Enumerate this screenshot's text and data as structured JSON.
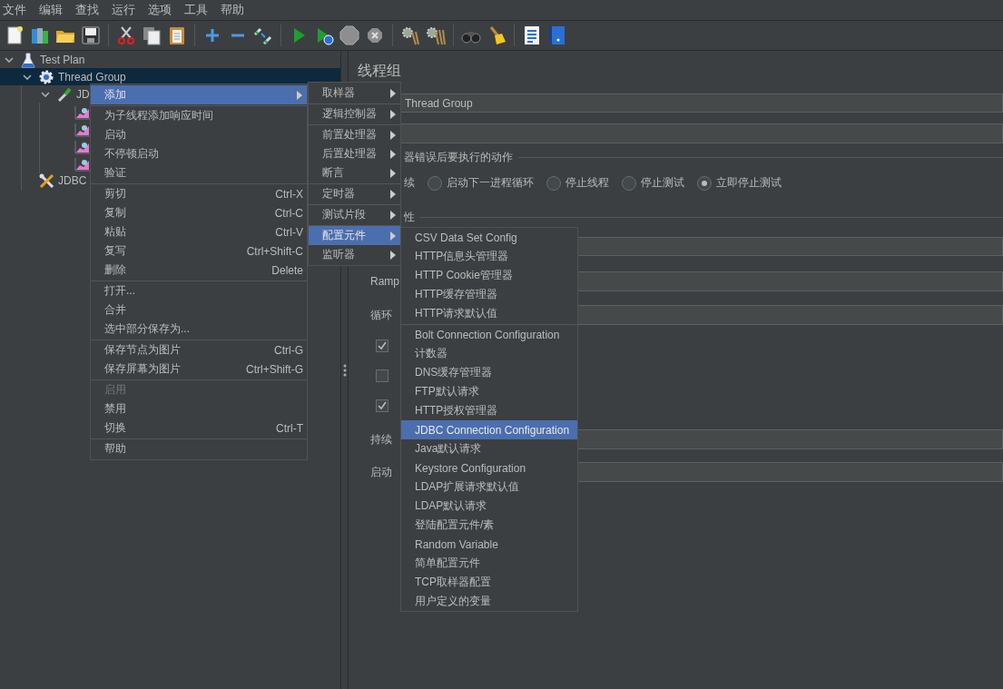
{
  "menu_bar": [
    "文件",
    "编辑",
    "查找",
    "运行",
    "选项",
    "工具",
    "帮助"
  ],
  "tree": [
    {
      "label": "Test Plan",
      "kind": "test-plan",
      "expanded": true,
      "selected": false,
      "children": [
        {
          "label": "Thread Group",
          "kind": "thread-group",
          "expanded": true,
          "selected": true,
          "children": [
            {
              "label": "JD",
              "kind": "sampler",
              "expanded": true,
              "selected": false,
              "children": [
                {
                  "kind": "listener",
                  "selected": false
                },
                {
                  "kind": "listener",
                  "selected": false
                },
                {
                  "kind": "listener",
                  "selected": false
                },
                {
                  "kind": "listener",
                  "selected": false
                }
              ]
            }
          ]
        },
        {
          "label": "JDBC",
          "kind": "config",
          "selected": false
        }
      ]
    }
  ],
  "panel": {
    "title": "线程组",
    "name_field": {
      "value": "Thread Group"
    },
    "error_section": {
      "heading": "器错误后要执行的动作",
      "partial_label": "续",
      "actions": [
        {
          "label": "启动下一进程循环",
          "selected": false
        },
        {
          "label": "停止线程",
          "selected": false
        },
        {
          "label": "停止测试",
          "selected": false
        },
        {
          "label": "立即停止测试",
          "selected": true
        }
      ]
    },
    "thread_section": {
      "heading": "性",
      "ramp_label": "Ramp",
      "loop_label": "循环",
      "checkboxes": [
        {
          "checked": true
        },
        {
          "checked": false
        },
        {
          "checked": true
        }
      ],
      "duration_label": "持续",
      "delay_label": "启动"
    }
  },
  "context_menu": {
    "groups": [
      [
        {
          "label": "添加",
          "submenu": true,
          "disabled": false,
          "selected": true
        }
      ],
      [
        {
          "label": "为子线程添加响应时间",
          "submenu": false,
          "disabled": false,
          "selected": false
        },
        {
          "label": "启动",
          "submenu": false,
          "disabled": false,
          "selected": false
        },
        {
          "label": "不停顿启动",
          "submenu": false,
          "disabled": false,
          "selected": false
        },
        {
          "label": "验证",
          "submenu": false,
          "disabled": false,
          "selected": false
        }
      ],
      [
        {
          "label": "剪切",
          "shortcut": "Ctrl-X",
          "submenu": false,
          "disabled": false,
          "selected": false
        },
        {
          "label": "复制",
          "shortcut": "Ctrl-C",
          "submenu": false,
          "disabled": false,
          "selected": false
        },
        {
          "label": "粘贴",
          "shortcut": "Ctrl-V",
          "submenu": false,
          "disabled": false,
          "selected": false
        },
        {
          "label": "复写",
          "shortcut": "Ctrl+Shift-C",
          "submenu": false,
          "disabled": false,
          "selected": false
        },
        {
          "label": "删除",
          "shortcut": "Delete",
          "submenu": false,
          "disabled": false,
          "selected": false
        }
      ],
      [
        {
          "label": "打开...",
          "submenu": false,
          "disabled": false,
          "selected": false
        },
        {
          "label": "合并",
          "submenu": false,
          "disabled": false,
          "selected": false
        },
        {
          "label": "选中部分保存为...",
          "submenu": false,
          "disabled": false,
          "selected": false
        }
      ],
      [
        {
          "label": "保存节点为图片",
          "shortcut": "Ctrl-G",
          "submenu": false,
          "disabled": false,
          "selected": false
        },
        {
          "label": "保存屏幕为图片",
          "shortcut": "Ctrl+Shift-G",
          "submenu": false,
          "disabled": false,
          "selected": false
        }
      ],
      [
        {
          "label": "启用",
          "submenu": false,
          "disabled": true,
          "selected": false
        },
        {
          "label": "禁用",
          "submenu": false,
          "disabled": false,
          "selected": false
        },
        {
          "label": "切换",
          "shortcut": "Ctrl-T",
          "submenu": false,
          "disabled": false,
          "selected": false
        }
      ],
      [
        {
          "label": "帮助",
          "submenu": false,
          "disabled": false,
          "selected": false
        }
      ]
    ]
  },
  "add_submenu": {
    "groups": [
      [
        {
          "label": "取样器",
          "submenu": true,
          "selected": false
        }
      ],
      [
        {
          "label": "逻辑控制器",
          "submenu": true,
          "selected": false
        }
      ],
      [
        {
          "label": "前置处理器",
          "submenu": true,
          "selected": false
        },
        {
          "label": "后置处理器",
          "submenu": true,
          "selected": false
        },
        {
          "label": "断言",
          "submenu": true,
          "selected": false
        }
      ],
      [
        {
          "label": "定时器",
          "submenu": true,
          "selected": false
        }
      ],
      [
        {
          "label": "测试片段",
          "submenu": true,
          "selected": false
        }
      ],
      [
        {
          "label": "配置元件",
          "submenu": true,
          "selected": true
        },
        {
          "label": "监听器",
          "submenu": true,
          "selected": false
        }
      ]
    ]
  },
  "config_submenu": {
    "groups": [
      [
        {
          "label": "CSV Data Set Config",
          "selected": false
        },
        {
          "label": "HTTP信息头管理器",
          "selected": false
        },
        {
          "label": "HTTP Cookie管理器",
          "selected": false
        },
        {
          "label": "HTTP缓存管理器",
          "selected": false
        },
        {
          "label": "HTTP请求默认值",
          "selected": false
        }
      ],
      [
        {
          "label": "Bolt Connection Configuration",
          "selected": false
        },
        {
          "label": "计数器",
          "selected": false
        },
        {
          "label": "DNS缓存管理器",
          "selected": false
        },
        {
          "label": "FTP默认请求",
          "selected": false
        },
        {
          "label": "HTTP授权管理器",
          "selected": false
        },
        {
          "label": "JDBC Connection Configuration",
          "selected": true
        },
        {
          "label": "Java默认请求",
          "selected": false
        },
        {
          "label": "Keystore Configuration",
          "selected": false
        },
        {
          "label": "LDAP扩展请求默认值",
          "selected": false
        },
        {
          "label": "LDAP默认请求",
          "selected": false
        },
        {
          "label": "登陆配置元件/素",
          "selected": false
        },
        {
          "label": "Random Variable",
          "selected": false
        },
        {
          "label": "简单配置元件",
          "selected": false
        },
        {
          "label": "TCP取样器配置",
          "selected": false
        },
        {
          "label": "用户定义的变量",
          "selected": false
        }
      ]
    ]
  }
}
